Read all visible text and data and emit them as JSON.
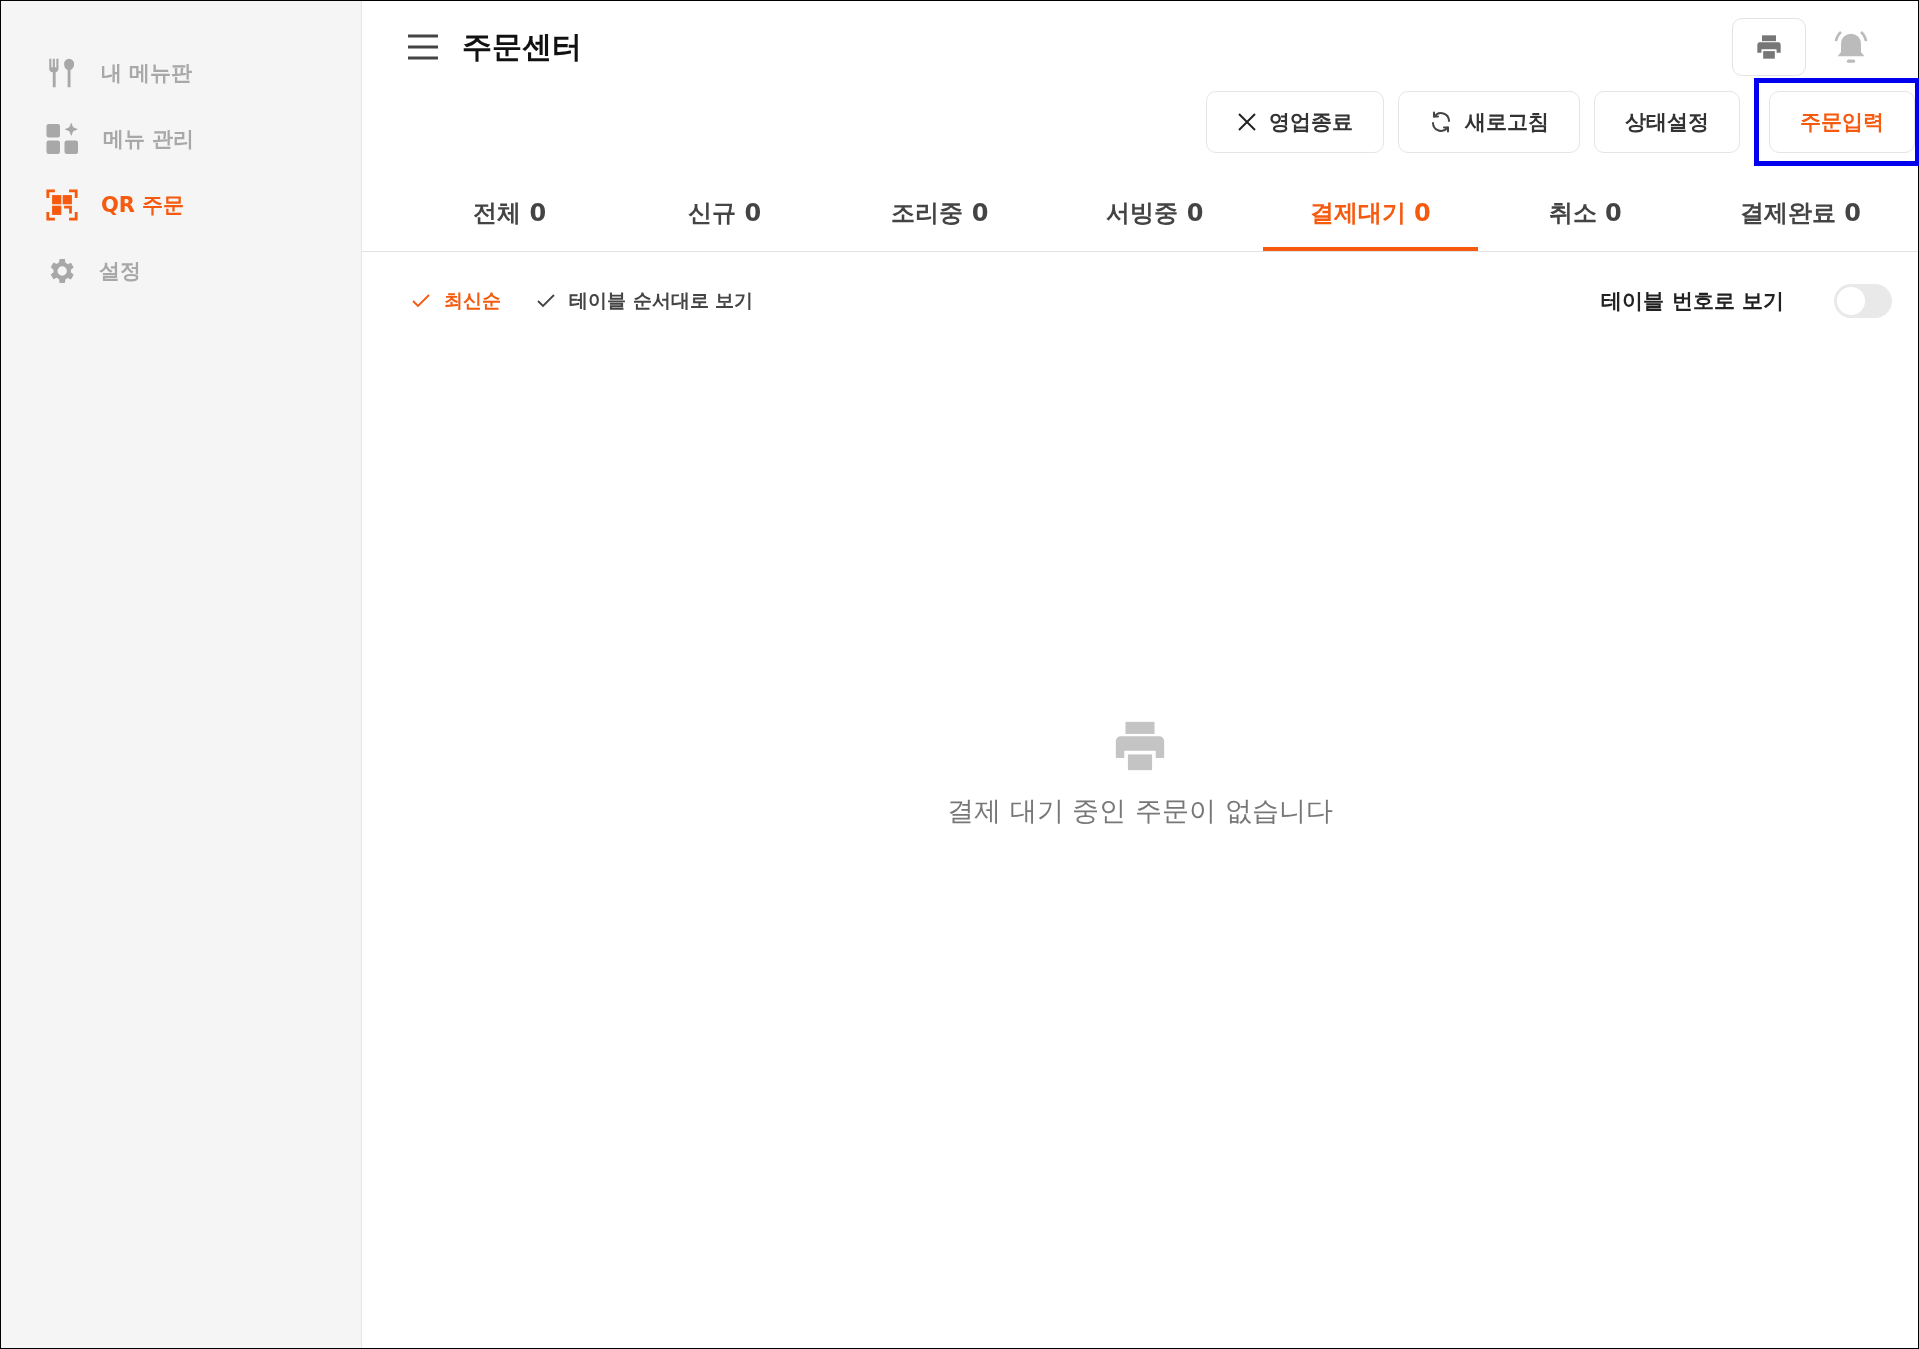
{
  "sidebar": {
    "items": [
      {
        "label": "내 메뉴판",
        "selected": false
      },
      {
        "label": "메뉴 관리",
        "selected": false
      },
      {
        "label": "QR 주문",
        "selected": true
      },
      {
        "label": "설정",
        "selected": false
      }
    ]
  },
  "header": {
    "title": "주문센터"
  },
  "actions": [
    {
      "label": "영업종료",
      "accent": false,
      "highlighted": false
    },
    {
      "label": "새로고침",
      "accent": false,
      "highlighted": false
    },
    {
      "label": "상태설정",
      "accent": false,
      "highlighted": false
    },
    {
      "label": "주문입력",
      "accent": true,
      "highlighted": true
    }
  ],
  "tabs": [
    {
      "label": "전체 0",
      "selected": false
    },
    {
      "label": "신규 0",
      "selected": false
    },
    {
      "label": "조리중 0",
      "selected": false
    },
    {
      "label": "서빙중 0",
      "selected": false
    },
    {
      "label": "결제대기 0",
      "selected": true
    },
    {
      "label": "취소 0",
      "selected": false
    },
    {
      "label": "결제완료 0",
      "selected": false
    }
  ],
  "sort_options": [
    {
      "label": "최신순",
      "selected": true
    },
    {
      "label": "테이블 순서대로 보기",
      "selected": false
    }
  ],
  "table_number_toggle": {
    "label": "테이블 번호로 보기",
    "on": false
  },
  "empty_state": {
    "message": "결제 대기 중인 주문이 없습니다"
  }
}
